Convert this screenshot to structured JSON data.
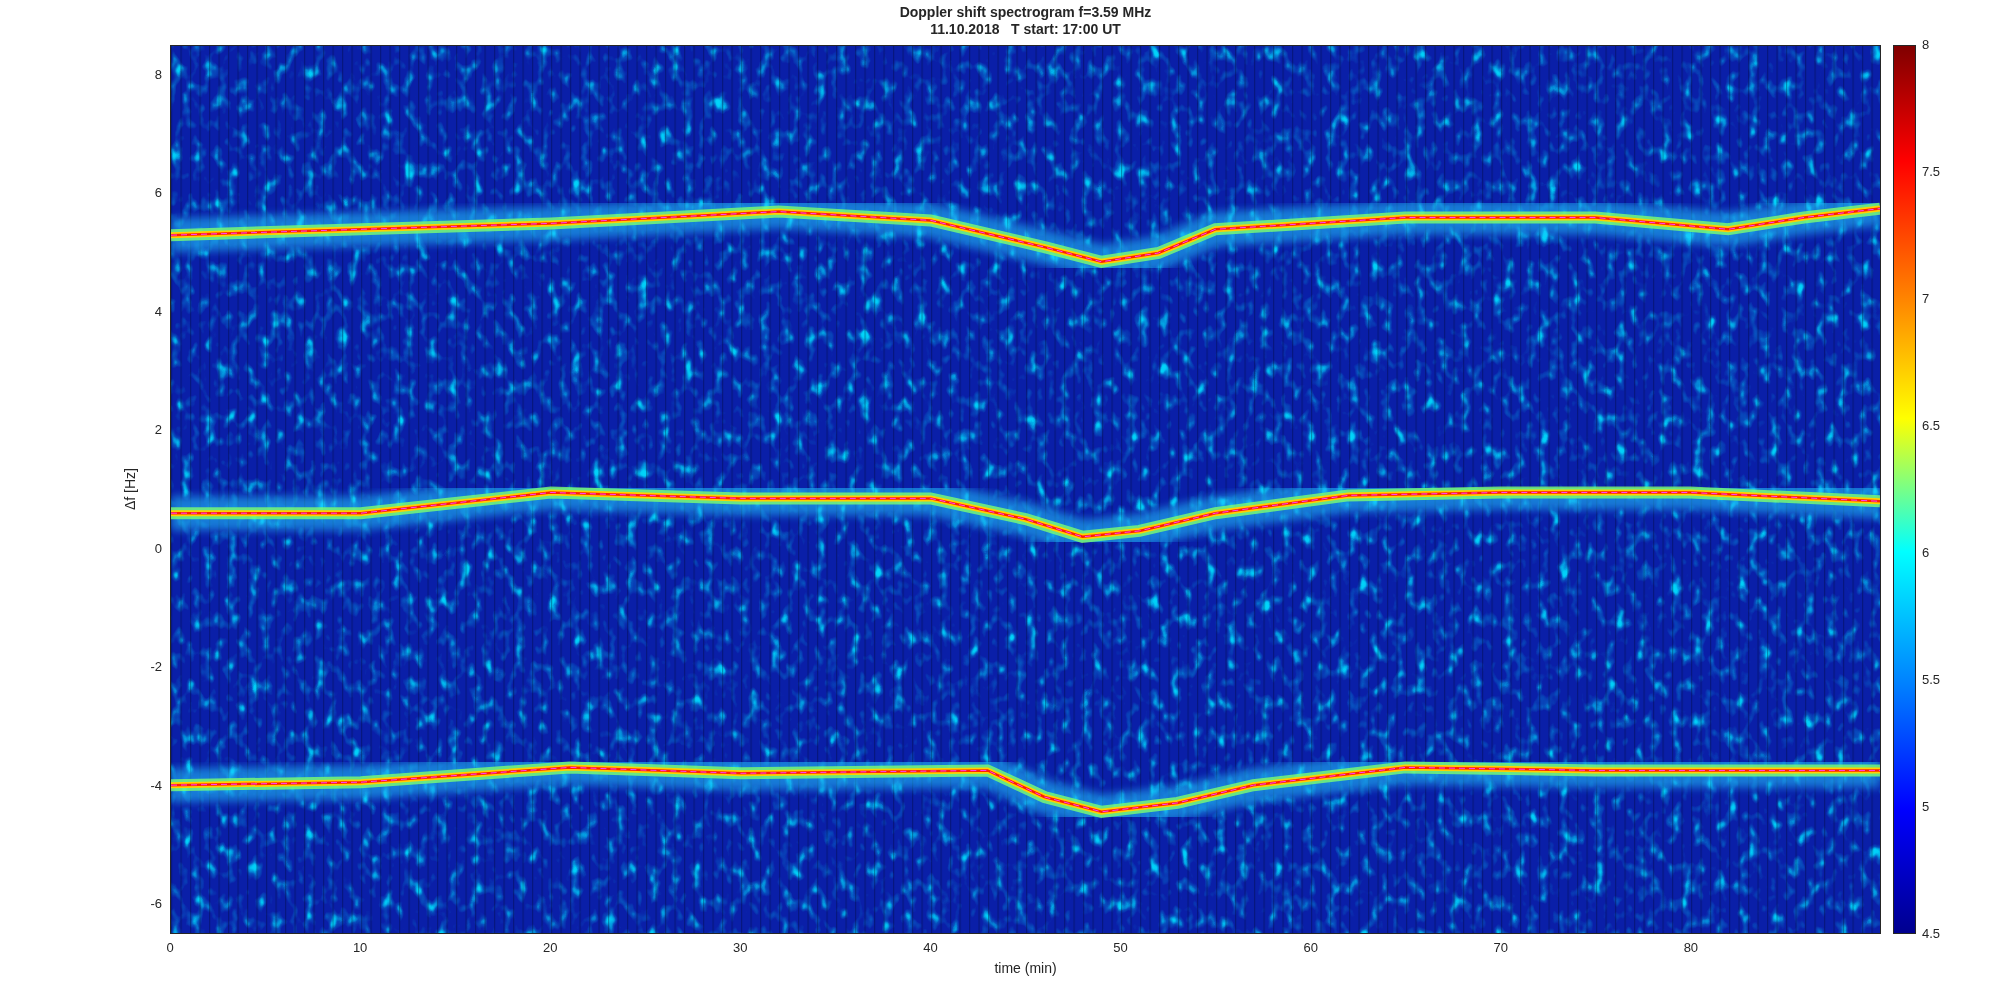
{
  "figure": {
    "title_lines": [
      "Doppler shift spectrogram f=3.59 MHz",
      "11.10.2018   T start: 17:00 UT"
    ],
    "ylabel": "Δf [Hz]",
    "yticks": [
      "8",
      "6",
      "4",
      "2",
      "0",
      "-2",
      "-4",
      "-6"
    ],
    "xticks": [
      "0",
      "10",
      "20",
      "30",
      "40",
      "50",
      "60",
      "70",
      "80"
    ],
    "xlabel": "time (min)",
    "colorbar": {
      "ticks": [
        "8",
        "7.5",
        "7",
        "6.5",
        "6",
        "5.5",
        "5",
        "4.5"
      ]
    }
  }
}
